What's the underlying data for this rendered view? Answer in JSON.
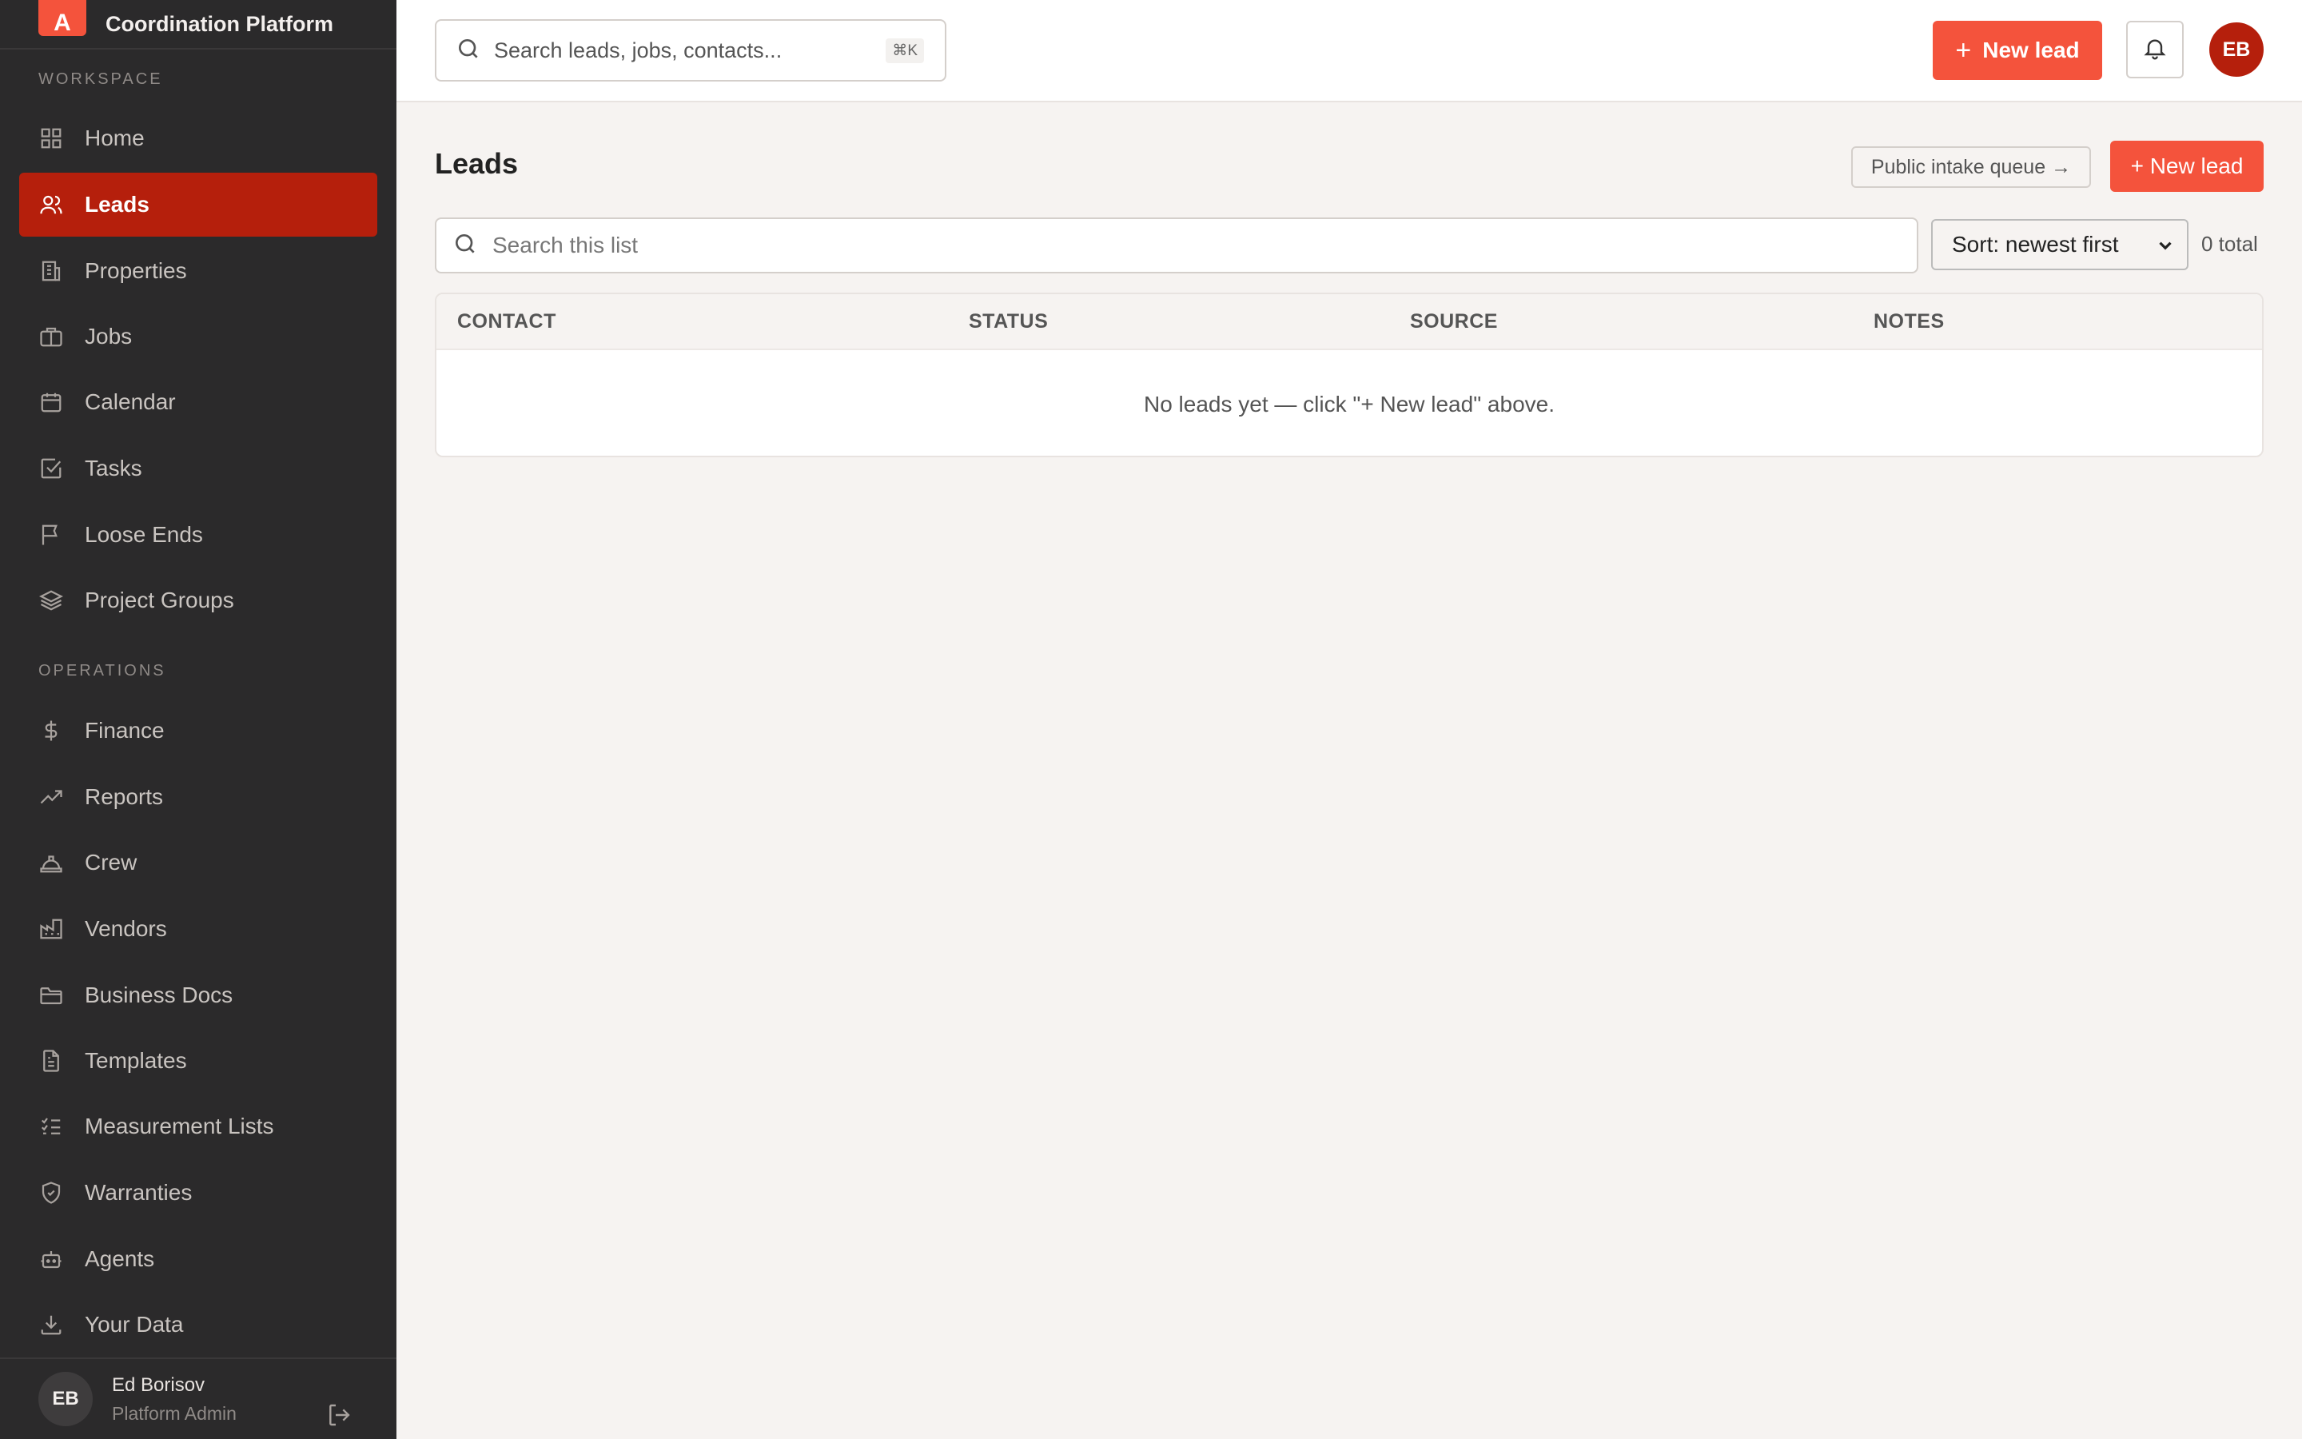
{
  "app": {
    "brand_letter": "A",
    "name": "Coordination Platform"
  },
  "sidebar": {
    "workspace_label": "WORKSPACE",
    "operations_label": "OPERATIONS",
    "workspace_items": [
      {
        "label": "Home",
        "icon": "grid-icon"
      },
      {
        "label": "Leads",
        "icon": "users-icon",
        "active": true
      },
      {
        "label": "Properties",
        "icon": "building-icon"
      },
      {
        "label": "Jobs",
        "icon": "briefcase-icon"
      },
      {
        "label": "Calendar",
        "icon": "calendar-icon"
      },
      {
        "label": "Tasks",
        "icon": "checkbox-icon"
      },
      {
        "label": "Loose Ends",
        "icon": "flag-icon"
      },
      {
        "label": "Project Groups",
        "icon": "layers-icon"
      }
    ],
    "operations_items": [
      {
        "label": "Finance",
        "icon": "dollar-icon"
      },
      {
        "label": "Reports",
        "icon": "trending-up-icon"
      },
      {
        "label": "Crew",
        "icon": "hard-hat-icon"
      },
      {
        "label": "Vendors",
        "icon": "factory-icon"
      },
      {
        "label": "Business Docs",
        "icon": "folder-icon"
      },
      {
        "label": "Templates",
        "icon": "document-icon"
      },
      {
        "label": "Measurement Lists",
        "icon": "list-checks-icon"
      },
      {
        "label": "Warranties",
        "icon": "shield-icon"
      },
      {
        "label": "Agents",
        "icon": "bot-icon"
      },
      {
        "label": "Your Data",
        "icon": "download-icon"
      }
    ],
    "user": {
      "initials": "EB",
      "name": "Ed Borisov",
      "role": "Platform Admin"
    }
  },
  "topbar": {
    "search_placeholder": "Search leads, jobs, contacts...",
    "search_shortcut": "⌘K",
    "new_lead_label": "New lead",
    "avatar_initials": "EB"
  },
  "main": {
    "title": "Leads",
    "intake_link": "Public intake queue →",
    "new_lead_label": "+ New lead",
    "list_search_placeholder": "Search this list",
    "sort_value": "Sort: newest first",
    "total": "0 total",
    "columns": [
      "CONTACT",
      "STATUS",
      "SOURCE",
      "NOTES"
    ],
    "empty_message": "No leads yet — click \"+ New lead\" above."
  },
  "colors": {
    "accent": "#f4533c",
    "active_nav": "#b51f0c",
    "sidebar_bg": "#2b2a2b",
    "page_bg": "#f6f3f1"
  }
}
